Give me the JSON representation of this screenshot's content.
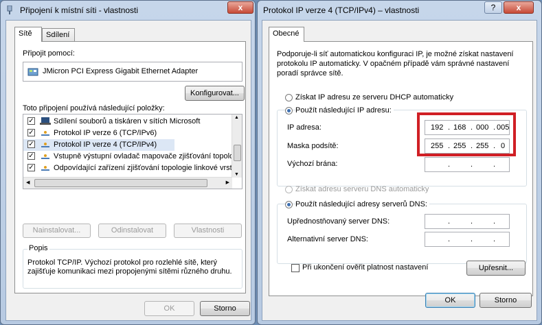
{
  "left_window": {
    "title": "Připojení k místní síti - vlastnosti",
    "tabs": [
      "Sítě",
      "Sdílení"
    ],
    "connect_using_label": "Připojit pomocí:",
    "adapter_name": "JMicron PCI Express Gigabit Ethernet Adapter",
    "configure_button": "Konfigurovat...",
    "items_label": "Toto připojení používá následující položky:",
    "items": [
      {
        "label": "Sdílení souborů a tiskáren v sítích Microsoft",
        "checked": true,
        "icon": "share-icon"
      },
      {
        "label": "Protokol IP verze 6 (TCP/IPv6)",
        "checked": true,
        "icon": "protocol-icon"
      },
      {
        "label": "Protokol IP verze 4 (TCP/IPv4)",
        "checked": true,
        "icon": "protocol-icon"
      },
      {
        "label": "Vstupně výstupní ovladač mapovače zjišťování topolo",
        "checked": true,
        "icon": "protocol-icon"
      },
      {
        "label": "Odpovídající zařízení zjišťování topologie linkové vrst",
        "checked": true,
        "icon": "protocol-icon"
      }
    ],
    "install_button": "Nainstalovat...",
    "uninstall_button": "Odinstalovat",
    "properties_button": "Vlastnosti",
    "description_label": "Popis",
    "description_text_1": "Protokol TCP/IP. Výchozí protokol pro rozlehlé sítě, který",
    "description_text_2": "zajišťuje komunikaci mezi propojenými sítěmi různého druhu.",
    "ok_button": "OK",
    "cancel_button": "Storno",
    "close_glyph": "x"
  },
  "right_window": {
    "title": "Protokol IP verze 4 (TCP/IPv4) – vlastnosti",
    "help_glyph": "?",
    "close_glyph": "x",
    "tab": "Obecné",
    "intro_1": "Podporuje-li síť automatickou konfiguraci IP, je možné získat nastavení",
    "intro_2": "protokolu IP automaticky. V opačném případě vám správné nastavení",
    "intro_3": "poradí správce sítě.",
    "radio_auto_ip": "Získat IP adresu ze serveru DHCP automaticky",
    "radio_manual_ip": "Použít následující IP adresu:",
    "ip_label": "IP adresa:",
    "ip_value": [
      "192",
      "168",
      "000",
      "005"
    ],
    "mask_label": "Maska podsítě:",
    "mask_value": [
      "255",
      "255",
      "255",
      "0"
    ],
    "gateway_label": "Výchozí brána:",
    "radio_auto_dns": "Získat adresu serveru DNS automaticky",
    "radio_manual_dns": "Použít následující adresy serverů DNS:",
    "preferred_dns_label": "Upřednostňovaný server DNS:",
    "alternate_dns_label": "Alternativní server DNS:",
    "validate_checkbox": "Při ukončení ověřit platnost nastavení",
    "advanced_button": "Upřesnit...",
    "ok_button": "OK",
    "cancel_button": "Storno",
    "dot": "."
  },
  "colors": {
    "highlight_box": "#d01f25",
    "selection": "#dce7f5"
  }
}
